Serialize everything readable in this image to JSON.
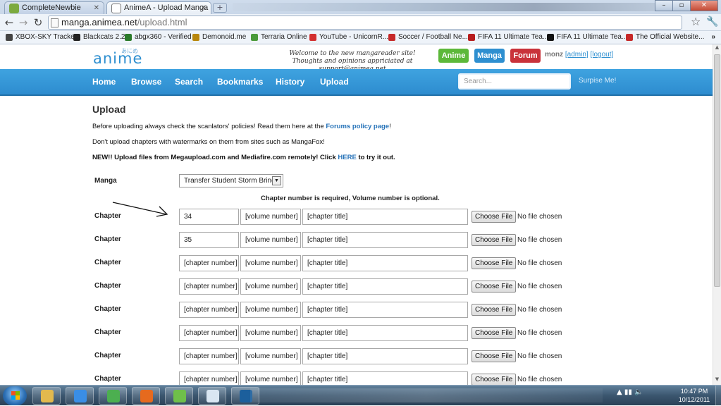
{
  "browser": {
    "tabs": [
      {
        "title": "CompleteNewbie",
        "active": false,
        "favicon_color": "#7caa3f"
      },
      {
        "title": "AnimeA - Upload Manga",
        "active": true,
        "favicon_color": "#2e8fd0"
      }
    ],
    "new_tab_symbol": "+",
    "url": {
      "host": "manga.animea.net",
      "path": "/upload.html"
    },
    "bookmarks": [
      {
        "label": "XBOX-SKY Tracker",
        "icon_color": "#444444"
      },
      {
        "label": "Blackcats 2.2",
        "icon_color": "#222222"
      },
      {
        "label": "abgx360 - Verified",
        "icon_color": "#2a7a2a"
      },
      {
        "label": "Demonoid.me",
        "icon_color": "#b8860b"
      },
      {
        "label": "Terraria Online",
        "icon_color": "#4a9a3a"
      },
      {
        "label": "YouTube - UnicornR...",
        "icon_color": "#d32f2f"
      },
      {
        "label": "Soccer / Football Ne...",
        "icon_color": "#c62828"
      },
      {
        "label": "FIFA 11 Ultimate Tea...",
        "icon_color": "#b71c1c"
      },
      {
        "label": "FIFA 11 Ultimate Tea...",
        "icon_color": "#111111"
      },
      {
        "label": "The Official Website...",
        "icon_color": "#c62828"
      }
    ],
    "bookmarks_more": "»"
  },
  "site": {
    "logo_text": "anime",
    "logo_kana": "あにめ",
    "welcome_line1": "Welcome to the new mangareader site!",
    "welcome_line2": "Thoughts and opinions appriciated at support@animea.net",
    "header_buttons": [
      {
        "label": "Anime",
        "color": "#5cb83a"
      },
      {
        "label": "Manga",
        "color": "#2e8fd0"
      },
      {
        "label": "Forum",
        "color": "#c9323a"
      }
    ],
    "username": "monz",
    "admin_link": "[admin]",
    "logout_link": "[logout]",
    "nav": [
      "Home",
      "Browse",
      "Search",
      "Bookmarks",
      "History",
      "Upload"
    ],
    "search_placeholder": "Search...",
    "surprise_label": "Surpise Me!"
  },
  "page": {
    "title": "Upload",
    "para1_prefix": "Before uploading always check the scanlators' policies! Read them here at the",
    "para1_link": "Forums policy page",
    "para1_suffix": "!",
    "para2": "Don't upload chapters with watermarks on them from sites such as MangaFox!",
    "para3_prefix": "NEW!! Upload files from Megaupload.com and Mediafire.com remotely! Click",
    "para3_link": "HERE",
    "para3_suffix": "to try it out.",
    "manga_label": "Manga",
    "manga_selected": "Transfer Student Storm Bring",
    "required_note": "Chapter number is required, Volume number is optional.",
    "chapter_label": "Chapter",
    "rows": [
      {
        "chapter": "34",
        "volume": "[volume number]",
        "title": "[chapter title]",
        "file_button": "Choose File",
        "file_status": "No file chosen"
      },
      {
        "chapter": "35",
        "volume": "[volume number]",
        "title": "[chapter title]",
        "file_button": "Choose File",
        "file_status": "No file chosen"
      },
      {
        "chapter": "[chapter number]",
        "volume": "[volume number]",
        "title": "[chapter title]",
        "file_button": "Choose File",
        "file_status": "No file chosen"
      },
      {
        "chapter": "[chapter number]",
        "volume": "[volume number]",
        "title": "[chapter title]",
        "file_button": "Choose File",
        "file_status": "No file chosen"
      },
      {
        "chapter": "[chapter number]",
        "volume": "[volume number]",
        "title": "[chapter title]",
        "file_button": "Choose File",
        "file_status": "No file chosen"
      },
      {
        "chapter": "[chapter number]",
        "volume": "[volume number]",
        "title": "[chapter title]",
        "file_button": "Choose File",
        "file_status": "No file chosen"
      },
      {
        "chapter": "[chapter number]",
        "volume": "[volume number]",
        "title": "[chapter title]",
        "file_button": "Choose File",
        "file_status": "No file chosen"
      },
      {
        "chapter": "[chapter number]",
        "volume": "[volume number]",
        "title": "[chapter title]",
        "file_button": "Choose File",
        "file_status": "No file chosen"
      }
    ]
  },
  "taskbar": {
    "apps": [
      {
        "name": "explorer-icon",
        "color": "#e2b94e"
      },
      {
        "name": "ie-icon",
        "color": "#3a8ee6"
      },
      {
        "name": "chrome-icon",
        "color": "#4caf50"
      },
      {
        "name": "firefox-icon",
        "color": "#e66a1e"
      },
      {
        "name": "messenger-icon",
        "color": "#6fbf4a"
      },
      {
        "name": "paint-icon",
        "color": "#d9e6f2"
      },
      {
        "name": "photoshop-icon",
        "color": "#1c5f9c"
      }
    ],
    "clock_time": "10:47 PM",
    "clock_date": "10/12/2011"
  }
}
